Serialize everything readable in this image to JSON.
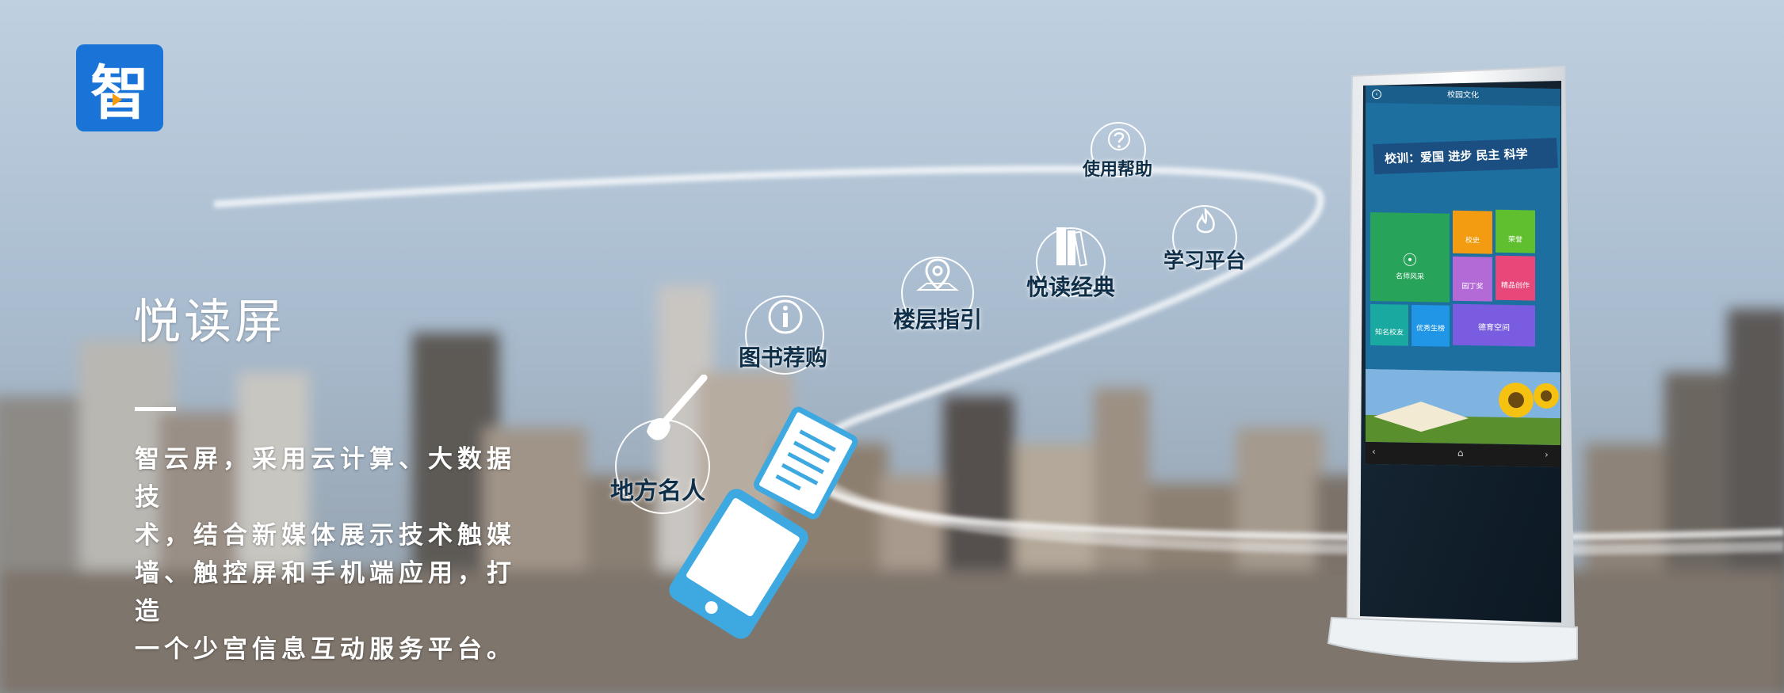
{
  "logo": {
    "char": "智",
    "icon": "play-triangle-icon"
  },
  "hero": {
    "title": "悦读屏",
    "description_lines": [
      "智云屏，采用云计算、大数据技",
      "术，结合新媒体展示技术触媒",
      "墙、触控屏和手机端应用，打造",
      "一个少宫信息互动服务平台。"
    ]
  },
  "features": [
    {
      "label": "地方名人",
      "icon": "pen-nib-icon"
    },
    {
      "label": "图书荐购",
      "icon": "info-icon"
    },
    {
      "label": "楼层指引",
      "icon": "map-pin-icon"
    },
    {
      "label": "悦读经典",
      "icon": "books-icon"
    },
    {
      "label": "学习平台",
      "icon": "flame-icon"
    },
    {
      "label": "使用帮助",
      "icon": "question-icon"
    }
  ],
  "kiosk": {
    "header": "校园文化",
    "motto": "校训：爱国 进步 民主 科学",
    "tiles": [
      "名师风采",
      "校史",
      "荣誉",
      "园丁奖",
      "精品创作",
      "知名校友",
      "优秀生榜",
      "德育空间"
    ]
  },
  "colors": {
    "accent": "#1a73d6",
    "text_dark": "#0f2f49",
    "phone_blue": "#3da9e0"
  }
}
